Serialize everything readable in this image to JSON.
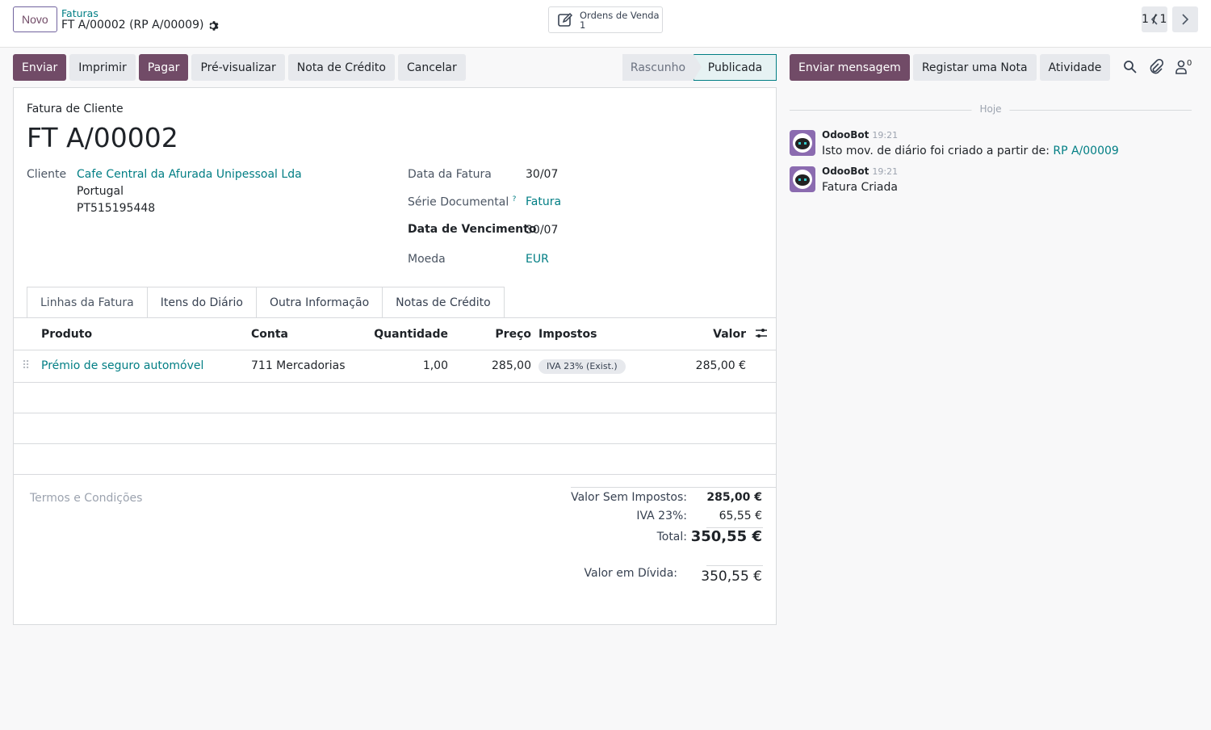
{
  "header": {
    "new_label": "Novo",
    "breadcrumb_parent": "Faturas",
    "breadcrumb_current": "FT A/00002 (RP A/00009)",
    "smart_button": {
      "label": "Ordens de Venda",
      "count": "1"
    },
    "pager": "1 / 1"
  },
  "actions": {
    "send": "Enviar",
    "print": "Imprimir",
    "pay": "Pagar",
    "preview": "Pré-visualizar",
    "credit_note": "Nota de Crédito",
    "cancel": "Cancelar"
  },
  "status": {
    "draft": "Rascunho",
    "posted": "Publicada"
  },
  "form": {
    "doc_type": "Fatura de Cliente",
    "doc_name": "FT A/00002",
    "customer_label": "Cliente",
    "customer_name": "Cafe Central da Afurada Unipessoal Lda",
    "customer_country": "Portugal",
    "customer_vat": "PT515195448",
    "invoice_date_label": "Data da Fatura",
    "invoice_date": "30/07",
    "series_label": "Série Documental",
    "series_help": "?",
    "series": "Fatura",
    "due_date_label": "Data de Vencimento",
    "due_date": "30/07",
    "currency_label": "Moeda",
    "currency": "EUR"
  },
  "tabs": [
    "Linhas da Fatura",
    "Itens do Diário",
    "Outra Informação",
    "Notas de Crédito"
  ],
  "table": {
    "headers": {
      "product": "Produto",
      "account": "Conta",
      "quantity": "Quantidade",
      "price": "Preço",
      "taxes": "Impostos",
      "amount": "Valor"
    },
    "rows": [
      {
        "product": "Prémio de seguro automóvel",
        "account": "711 Mercadorias",
        "quantity": "1,00",
        "price": "285,00",
        "tax": "IVA 23% (Exist.)",
        "amount": "285,00 €"
      }
    ]
  },
  "totals": {
    "terms_placeholder": "Termos e Condições",
    "untaxed_label": "Valor Sem Impostos:",
    "untaxed": "285,00 €",
    "vat_label": "IVA 23%:",
    "vat": "65,55 €",
    "total_label": "Total:",
    "total": "350,55 €",
    "due_label": "Valor em Dívida:",
    "due": "350,55 €"
  },
  "chatter": {
    "send_message": "Enviar mensagem",
    "log_note": "Registar uma Nota",
    "activity": "Atividade",
    "followers_count": "0",
    "today": "Hoje",
    "messages": [
      {
        "author": "OdooBot",
        "time": "19:21",
        "text": "Isto mov. de diário foi criado a partir de: ",
        "link": "RP A/00009"
      },
      {
        "author": "OdooBot",
        "time": "19:21",
        "text": "Fatura Criada"
      }
    ]
  },
  "colors": {
    "primary": "#714b67",
    "link": "#017e84",
    "secondary": "#e7e9ed"
  }
}
